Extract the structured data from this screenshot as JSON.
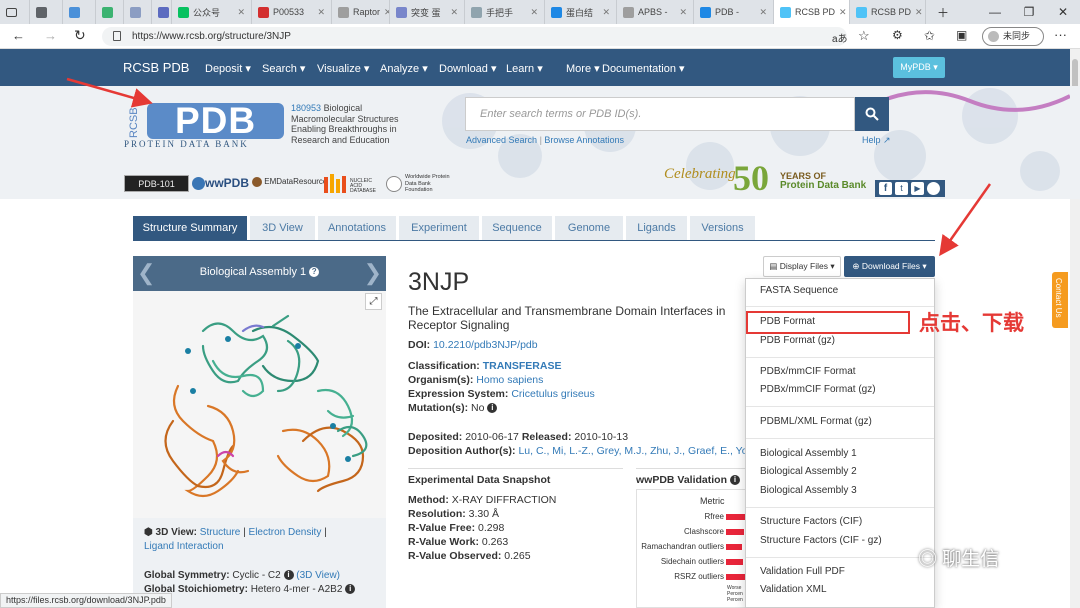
{
  "browser": {
    "tabs": [
      {
        "label": "",
        "color": "#5f6368"
      },
      {
        "label": "",
        "color": "#4a90d9"
      },
      {
        "label": "",
        "color": "#3cb371"
      },
      {
        "label": "",
        "color": "#8b9dc3"
      },
      {
        "label": "",
        "color": "#5c6bc0"
      },
      {
        "label": "公众号",
        "color": "#07c160"
      },
      {
        "label": "P00533",
        "color": "#d32f2f"
      },
      {
        "label": "Raptor",
        "color": "#9e9e9e"
      },
      {
        "label": "突变 蛋",
        "color": "#7986cb"
      },
      {
        "label": "手把手",
        "color": "#90a4ae"
      },
      {
        "label": "蛋白结",
        "color": "#1e88e5"
      },
      {
        "label": "APBS -",
        "color": "#9e9e9e"
      },
      {
        "label": "PDB - ",
        "color": "#1e88e5"
      },
      {
        "label": "RCSB PD",
        "color": "#4fc3f7"
      },
      {
        "label": "RCSB PD",
        "color": "#4fc3f7"
      }
    ],
    "url": "https://www.rcsb.org/structure/3NJP",
    "profile_label": "未同步",
    "status_url": "https://files.rcsb.org/download/3NJP.pdb"
  },
  "header": {
    "brand": "RCSB PDB",
    "nav": [
      "Deposit",
      "Search",
      "Visualize",
      "Analyze",
      "Download",
      "Learn",
      "More",
      "Documentation"
    ],
    "mypdb": "MyPDB",
    "logo_text": "PDB",
    "logo_side": "RCSB",
    "logo_sub": "PROTEIN DATA BANK",
    "count": "180953",
    "tagline_1": "Biological",
    "tagline_2": "Macromolecular Structures",
    "tagline_3": "Enabling Breakthroughs in",
    "tagline_4": "Research and Education",
    "search_placeholder": "Enter search terms or PDB ID(s).",
    "advanced_search": "Advanced Search",
    "browse_annotations": "Browse Annotations",
    "help": "Help",
    "partners": [
      "PDB-101",
      "wwPDB",
      "EMDataResource",
      "NUCLEIC ACID DATABASE",
      "Worldwide Protein Data Bank Foundation"
    ],
    "celebrating": "Celebrating",
    "anniversary_num": "50",
    "anniversary_text_1": "YEARS OF",
    "anniversary_text_2": "Protein Data Bank"
  },
  "tabs": [
    "Structure Summary",
    "3D View",
    "Annotations",
    "Experiment",
    "Sequence",
    "Genome",
    "Ligands",
    "Versions"
  ],
  "viewer": {
    "title": "Biological Assembly 1",
    "view_3d_label": "3D View:",
    "view_links": [
      "Structure",
      "Electron Density",
      "Ligand Interaction"
    ],
    "global_symmetry_label": "Global Symmetry:",
    "global_symmetry_value": "Cyclic - C2",
    "symmetry_link": "(3D View)",
    "stoichiometry_label": "Global Stoichiometry:",
    "stoichiometry_value": "Hetero 4-mer - A2B2"
  },
  "entry": {
    "id": "3NJP",
    "title_line1": "The Extracellular and Transmembrane Domain Interfaces in",
    "title_line2": "Receptor Signaling",
    "doi_label": "DOI:",
    "doi": "10.2210/pdb3NJP/pdb",
    "classification_label": "Classification:",
    "classification": "TRANSFERASE",
    "organism_label": "Organism(s):",
    "organism": "Homo sapiens",
    "expression_label": "Expression System:",
    "expression": "Cricetulus griseus",
    "mutation_label": "Mutation(s):",
    "mutation": "No",
    "deposited_label": "Deposited:",
    "deposited": "2010-06-17",
    "released_label": "Released:",
    "released": "2010-10-13",
    "authors_label": "Deposition Author(s):",
    "authors": "Lu, C., Mi, L.-Z., Grey, M.J., Zhu, J., Graef, E., Yokoya"
  },
  "snapshot": {
    "title": "Experimental Data Snapshot",
    "method_label": "Method:",
    "method": "X-RAY DIFFRACTION",
    "resolution_label": "Resolution:",
    "resolution": "3.30 Å",
    "rfree_label": "R-Value Free:",
    "rfree": "0.298",
    "rwork_label": "R-Value Work:",
    "rwork": "0.263",
    "robs_label": "R-Value Observed:",
    "robs": "0.265"
  },
  "validation": {
    "title": "wwPDB Validation",
    "metric_header": "Metric",
    "metrics": [
      "Rfree",
      "Clashscore",
      "Ramachandran outliers",
      "Sidechain outliers",
      "RSRZ outliers"
    ],
    "legend": [
      "Worse",
      "Percen",
      "Percen"
    ]
  },
  "files": {
    "display": "Display Files",
    "download": "Download Files",
    "menu": [
      [
        "FASTA Sequence"
      ],
      [
        "PDB Format",
        "PDB Format (gz)"
      ],
      [
        "PDBx/mmCIF Format",
        "PDBx/mmCIF Format (gz)"
      ],
      [
        "PDBML/XML Format (gz)"
      ],
      [
        "Biological Assembly 1",
        "Biological Assembly 2",
        "Biological Assembly 3"
      ],
      [
        "Structure Factors (CIF)",
        "Structure Factors (CIF - gz)"
      ],
      [
        "Validation Full PDF",
        "Validation XML"
      ]
    ]
  },
  "annotation": {
    "callout": "点击、下载",
    "watermark": "聊生信",
    "contact": "Contact Us",
    "accent": "#e53935"
  }
}
